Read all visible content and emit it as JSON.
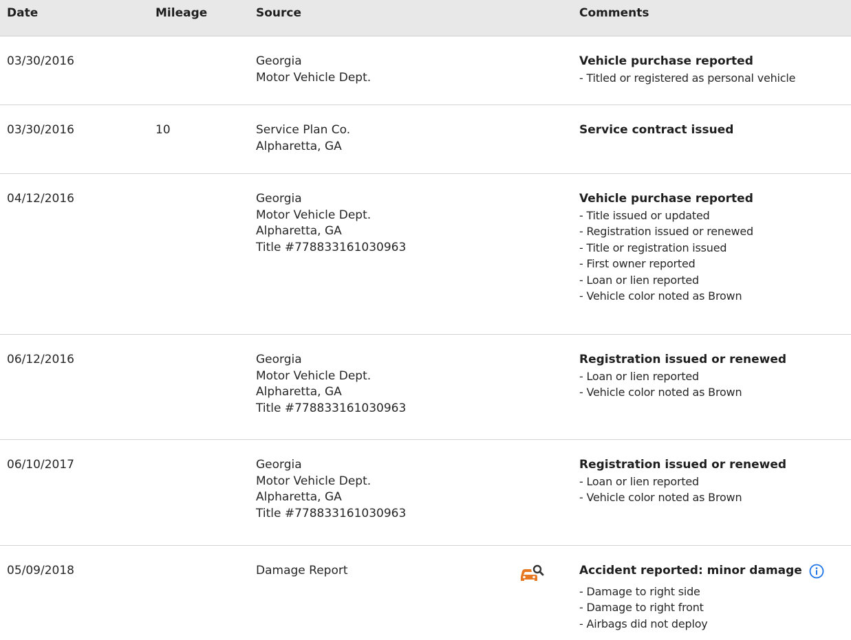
{
  "colors": {
    "header_bg": "#e8e8e8",
    "accent_orange": "#e87722",
    "info_blue": "#1a73e8"
  },
  "header": {
    "date": "Date",
    "mileage": "Mileage",
    "source": "Source",
    "comments": "Comments"
  },
  "rows": [
    {
      "date": "03/30/2016",
      "mileage": "",
      "source": [
        "Georgia",
        "Motor Vehicle Dept."
      ],
      "comment_title": "Vehicle purchase reported",
      "comment_items": [
        "- Titled or registered as personal vehicle"
      ]
    },
    {
      "date": "03/30/2016",
      "mileage": "10",
      "source": [
        "Service Plan Co.",
        "Alpharetta, GA"
      ],
      "comment_title": "Service contract issued",
      "comment_items": []
    },
    {
      "date": "04/12/2016",
      "mileage": "",
      "source": [
        "Georgia",
        "Motor Vehicle Dept.",
        "Alpharetta, GA",
        "Title #778833161030963"
      ],
      "comment_title": "Vehicle purchase reported",
      "comment_items": [
        "- Title issued or updated",
        "- Registration issued or renewed",
        "- Title or registration issued",
        "- First owner reported",
        "- Loan or lien reported",
        "- Vehicle color noted as Brown"
      ]
    },
    {
      "date": "06/12/2016",
      "mileage": "",
      "source": [
        "Georgia",
        "Motor Vehicle Dept.",
        "Alpharetta, GA",
        "Title #778833161030963"
      ],
      "comment_title": "Registration issued or renewed",
      "comment_items": [
        "- Loan or lien reported",
        "- Vehicle color noted as Brown"
      ]
    },
    {
      "date": "06/10/2017",
      "mileage": "",
      "source": [
        "Georgia",
        "Motor Vehicle Dept.",
        "Alpharetta, GA",
        "Title #778833161030963"
      ],
      "comment_title": "Registration issued or renewed",
      "comment_items": [
        "- Loan or lien reported",
        "- Vehicle color noted as Brown"
      ]
    },
    {
      "date": "05/09/2018",
      "mileage": "",
      "source": [
        "Damage Report"
      ],
      "source_icon": "car-damage-search-icon",
      "comment_title": "Accident reported: minor damage",
      "comment_title_icon": "info-icon",
      "comment_items": [
        "- Damage to right side",
        "- Damage to right front",
        "- Airbags did not deploy"
      ]
    }
  ]
}
